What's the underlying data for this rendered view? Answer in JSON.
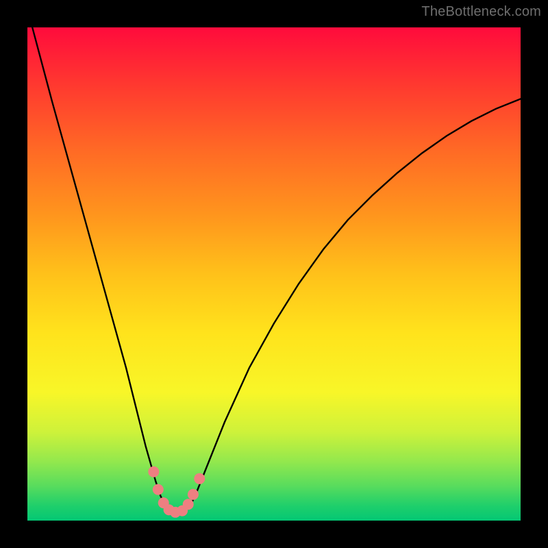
{
  "watermark": "TheBottleneck.com",
  "chart_data": {
    "type": "line",
    "title": "",
    "xlabel": "",
    "ylabel": "",
    "xlim": [
      0,
      100
    ],
    "ylim": [
      0,
      100
    ],
    "series": [
      {
        "name": "bottleneck-curve",
        "x": [
          1,
          5,
          10,
          15,
          20,
          22,
          24,
          26,
          27,
          28,
          29,
          30,
          31,
          32,
          33,
          34,
          36,
          40,
          45,
          50,
          55,
          60,
          65,
          70,
          75,
          80,
          85,
          90,
          95,
          100
        ],
        "y": [
          100,
          85,
          67,
          49,
          31,
          23,
          15,
          8,
          5,
          3,
          2,
          1.5,
          1.5,
          2,
          3,
          5,
          10,
          20,
          31,
          40,
          48,
          55,
          61,
          66,
          70.5,
          74.5,
          78,
          81,
          83.5,
          85.5
        ]
      }
    ],
    "markers": {
      "name": "highlight-dots",
      "color": "#ee7f81",
      "points": [
        {
          "x": 25.6,
          "y": 9.9
        },
        {
          "x": 26.5,
          "y": 6.3
        },
        {
          "x": 27.6,
          "y": 3.6
        },
        {
          "x": 28.7,
          "y": 2.2
        },
        {
          "x": 30.0,
          "y": 1.7
        },
        {
          "x": 31.4,
          "y": 2.0
        },
        {
          "x": 32.6,
          "y": 3.3
        },
        {
          "x": 33.6,
          "y": 5.3
        },
        {
          "x": 34.9,
          "y": 8.5
        }
      ]
    },
    "colors": {
      "curve": "#000000",
      "marker": "#ee7f81",
      "gradient_top": "#ff0b3c",
      "gradient_bottom": "#04c774",
      "frame": "#000000"
    }
  }
}
